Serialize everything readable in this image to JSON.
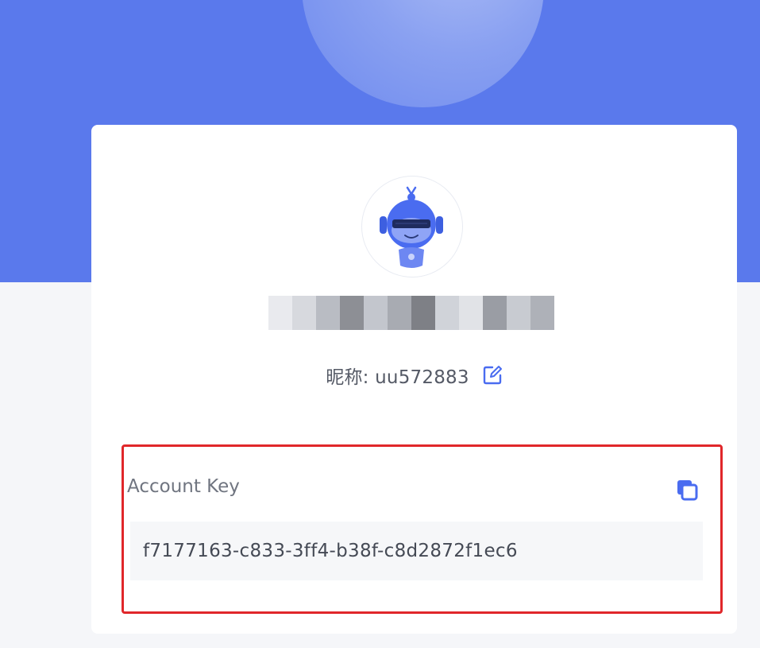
{
  "profile": {
    "nickname_label": "昵称: uu572883",
    "avatar_icon": "robot-avatar-icon",
    "masked_name_icon": "pixelated-name-redaction",
    "edit_icon": "edit-pencil-icon"
  },
  "account_key": {
    "label": "Account Key",
    "value": "f7177163-c833-3ff4-b38f-c8d2872f1ec6",
    "copy_icon": "copy-icon"
  },
  "colors": {
    "banner": "#5a79ec",
    "accent": "#4a6cf0",
    "highlight_border": "#e0272a"
  }
}
